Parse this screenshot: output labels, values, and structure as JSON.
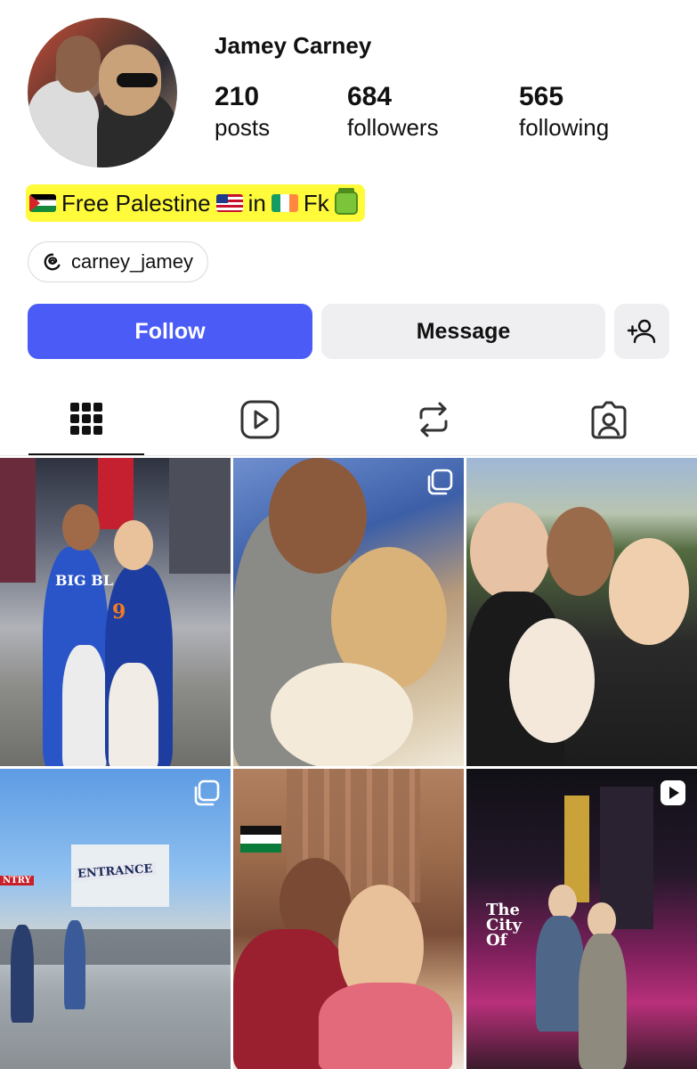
{
  "profile": {
    "username": "Jamey Carney",
    "stats": {
      "posts": {
        "count": "210",
        "label": "posts"
      },
      "followers": {
        "count": "684",
        "label": "followers"
      },
      "following": {
        "count": "565",
        "label": "following"
      }
    },
    "bio": {
      "segments": [
        "Free Palestine",
        "in",
        "Fk"
      ],
      "highlight_color": "#fffb3a",
      "emoji": [
        "flag-palestine",
        "flag-usa",
        "flag-ireland",
        "pickle-jar"
      ]
    },
    "threads_handle": "carney_jamey"
  },
  "actions": {
    "follow_label": "Follow",
    "message_label": "Message",
    "add_friend_icon": "person-plus-icon",
    "follow_color": "#4a5cf5"
  },
  "tabs": [
    {
      "icon": "grid-icon",
      "active": true
    },
    {
      "icon": "reels-icon",
      "active": false
    },
    {
      "icon": "repost-icon",
      "active": false
    },
    {
      "icon": "tagged-icon",
      "active": false
    }
  ],
  "posts": [
    {
      "type": "photo",
      "sign_text": "BIG BL",
      "jersey_number": "9"
    },
    {
      "type": "carousel"
    },
    {
      "type": "photo"
    },
    {
      "type": "carousel",
      "sign_text": "ENTRANCE",
      "side_text": "NTRY"
    },
    {
      "type": "photo"
    },
    {
      "type": "reel",
      "sign_text": "The City Of"
    }
  ]
}
